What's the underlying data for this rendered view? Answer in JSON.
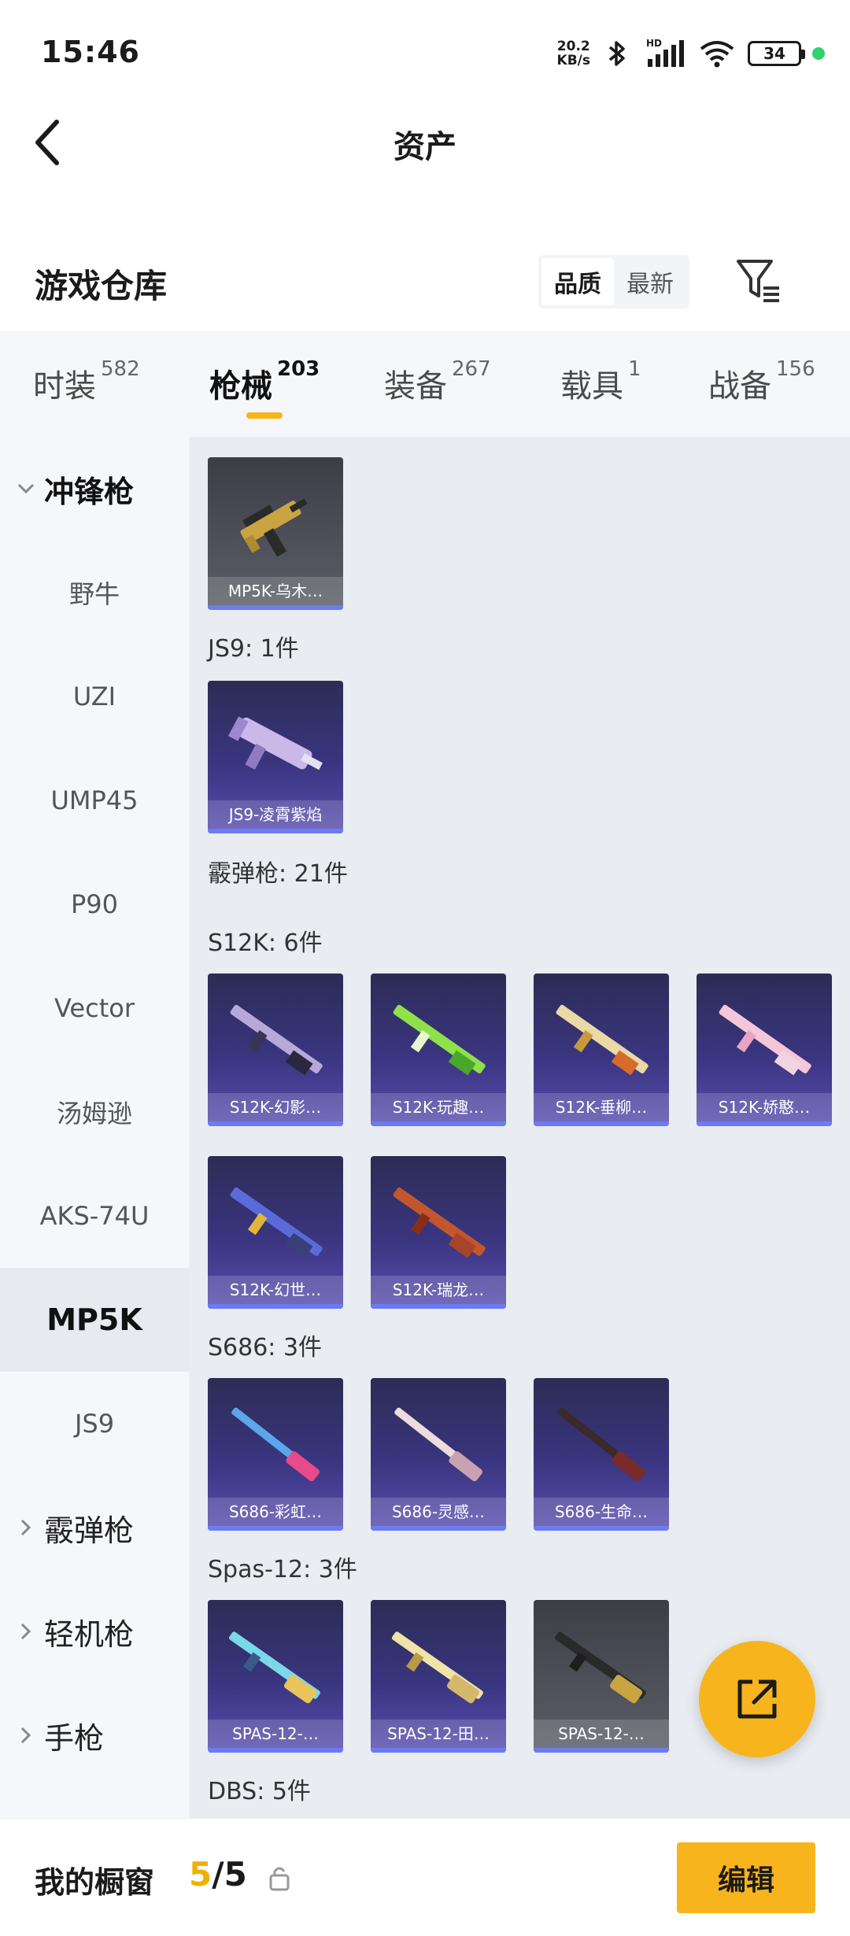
{
  "status_bar": {
    "time": "15:46",
    "speed_value": "20.2",
    "speed_unit": "KB/s",
    "battery": "34",
    "network_label": "HD"
  },
  "header": {
    "title": "资产",
    "back_icon": "chevron-left-icon"
  },
  "warehouse": {
    "title": "游戏仓库",
    "sort_options": [
      "品质",
      "最新"
    ],
    "active_sort": "品质",
    "filter_icon": "filter-icon"
  },
  "tabs": [
    {
      "label": "时装",
      "count": "582"
    },
    {
      "label": "枪械",
      "count": "203",
      "active": true
    },
    {
      "label": "装备",
      "count": "267"
    },
    {
      "label": "载具",
      "count": "1"
    },
    {
      "label": "战备",
      "count": "156"
    }
  ],
  "sidebar": {
    "items": [
      {
        "label": "冲锋枪",
        "type": "group",
        "expanded": true
      },
      {
        "label": "野牛"
      },
      {
        "label": "UZI"
      },
      {
        "label": "UMP45"
      },
      {
        "label": "P90"
      },
      {
        "label": "Vector"
      },
      {
        "label": "汤姆逊"
      },
      {
        "label": "AKS-74U"
      },
      {
        "label": "MP5K",
        "selected": true
      },
      {
        "label": "JS9"
      },
      {
        "label": "霰弹枪",
        "type": "group"
      },
      {
        "label": "轻机枪",
        "type": "group"
      },
      {
        "label": "手枪",
        "type": "group"
      }
    ]
  },
  "content": {
    "group_labels": {
      "js9": "JS9: 1件",
      "shotgun": "霰弹枪: 21件",
      "s12k": "S12K: 6件",
      "s686": "S686: 3件",
      "spas": "Spas-12: 3件",
      "dbs": "DBS: 5件"
    },
    "items": {
      "mp5k": {
        "label": "MP5K-乌木…",
        "rarity": "grey"
      },
      "js9": {
        "label": "JS9-凌霄紫焰",
        "rarity": "purple"
      },
      "s12k_1": {
        "label": "S12K-幻影…",
        "rarity": "purple"
      },
      "s12k_2": {
        "label": "S12K-玩趣…",
        "rarity": "purple"
      },
      "s12k_3": {
        "label": "S12K-垂柳…",
        "rarity": "purple"
      },
      "s12k_4": {
        "label": "S12K-娇憨…",
        "rarity": "purple"
      },
      "s12k_5": {
        "label": "S12K-幻世…",
        "rarity": "purple"
      },
      "s12k_6": {
        "label": "S12K-瑞龙…",
        "rarity": "purple"
      },
      "s686_1": {
        "label": "S686-彩虹…",
        "rarity": "purple"
      },
      "s686_2": {
        "label": "S686-灵感…",
        "rarity": "purple"
      },
      "s686_3": {
        "label": "S686-生命…",
        "rarity": "purple"
      },
      "spas_1": {
        "label": "SPAS-12-…",
        "rarity": "purple"
      },
      "spas_2": {
        "label": "SPAS-12-田…",
        "rarity": "purple"
      },
      "spas_3": {
        "label": "SPAS-12-…",
        "rarity": "grey"
      }
    }
  },
  "fab": {
    "icon": "share-external-icon"
  },
  "bottom_bar": {
    "title": "我的橱窗",
    "current": "5",
    "separator": "/",
    "total": "5",
    "lock_icon": "lock-icon",
    "edit_label": "编辑"
  }
}
